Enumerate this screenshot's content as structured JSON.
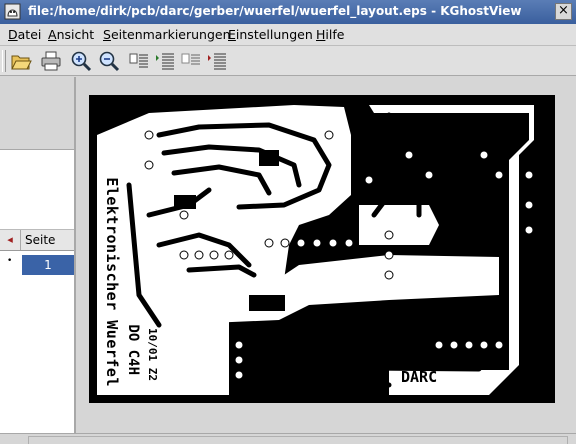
{
  "window": {
    "title": "file:/home/dirk/pcb/darc/gerber/wuerfel/wuerfel_layout.eps - KGhostView",
    "close_glyph": "×"
  },
  "menu": {
    "items": [
      {
        "accel": "D",
        "rest": "atei"
      },
      {
        "accel": "A",
        "rest": "nsicht"
      },
      {
        "accel": "S",
        "rest": "eitenmarkierungen"
      },
      {
        "accel": "E",
        "rest": "instellungen"
      },
      {
        "accel": "H",
        "rest": "ilfe"
      }
    ]
  },
  "toolbar": {
    "buttons": [
      "open-icon",
      "print-icon",
      "zoom-in-icon",
      "zoom-out-icon",
      "mark-page-icon",
      "mark-all-icon",
      "unmark-page-icon",
      "toggle-marks-icon"
    ]
  },
  "pagelist": {
    "column_header": "Seite",
    "marker_glyph": "◂",
    "rows": [
      {
        "marker": "•",
        "page": "1"
      }
    ]
  },
  "document": {
    "mirrored_text": [
      "Elektronischer Wuerfel",
      "DO C4H",
      "10/01 Z2",
      "DARC"
    ],
    "colors": {
      "board": "#000000",
      "copper": "#ffffff",
      "selection": "#3a63a7",
      "titlebar": "#3a5f9e"
    }
  }
}
